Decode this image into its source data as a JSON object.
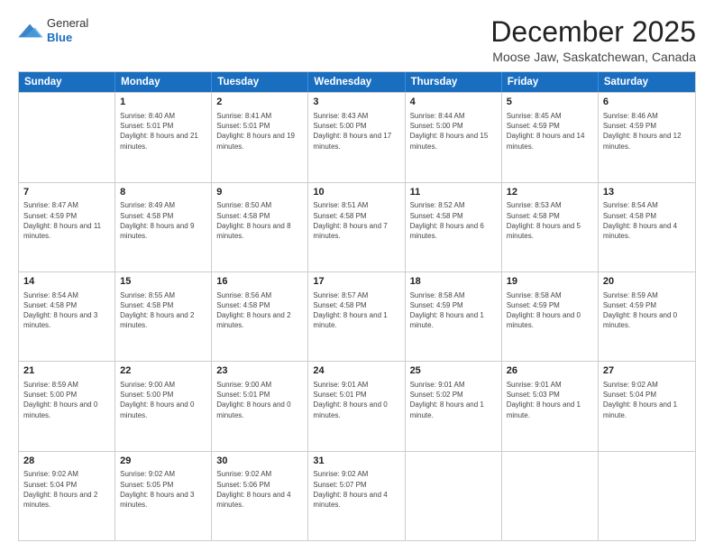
{
  "header": {
    "logo": {
      "line1": "General",
      "line2": "Blue"
    },
    "title": "December 2025",
    "subtitle": "Moose Jaw, Saskatchewan, Canada"
  },
  "calendar": {
    "days_of_week": [
      "Sunday",
      "Monday",
      "Tuesday",
      "Wednesday",
      "Thursday",
      "Friday",
      "Saturday"
    ],
    "rows": [
      [
        {
          "day": "",
          "sunrise": "",
          "sunset": "",
          "daylight": ""
        },
        {
          "day": "1",
          "sunrise": "Sunrise: 8:40 AM",
          "sunset": "Sunset: 5:01 PM",
          "daylight": "Daylight: 8 hours and 21 minutes."
        },
        {
          "day": "2",
          "sunrise": "Sunrise: 8:41 AM",
          "sunset": "Sunset: 5:01 PM",
          "daylight": "Daylight: 8 hours and 19 minutes."
        },
        {
          "day": "3",
          "sunrise": "Sunrise: 8:43 AM",
          "sunset": "Sunset: 5:00 PM",
          "daylight": "Daylight: 8 hours and 17 minutes."
        },
        {
          "day": "4",
          "sunrise": "Sunrise: 8:44 AM",
          "sunset": "Sunset: 5:00 PM",
          "daylight": "Daylight: 8 hours and 15 minutes."
        },
        {
          "day": "5",
          "sunrise": "Sunrise: 8:45 AM",
          "sunset": "Sunset: 4:59 PM",
          "daylight": "Daylight: 8 hours and 14 minutes."
        },
        {
          "day": "6",
          "sunrise": "Sunrise: 8:46 AM",
          "sunset": "Sunset: 4:59 PM",
          "daylight": "Daylight: 8 hours and 12 minutes."
        }
      ],
      [
        {
          "day": "7",
          "sunrise": "Sunrise: 8:47 AM",
          "sunset": "Sunset: 4:59 PM",
          "daylight": "Daylight: 8 hours and 11 minutes."
        },
        {
          "day": "8",
          "sunrise": "Sunrise: 8:49 AM",
          "sunset": "Sunset: 4:58 PM",
          "daylight": "Daylight: 8 hours and 9 minutes."
        },
        {
          "day": "9",
          "sunrise": "Sunrise: 8:50 AM",
          "sunset": "Sunset: 4:58 PM",
          "daylight": "Daylight: 8 hours and 8 minutes."
        },
        {
          "day": "10",
          "sunrise": "Sunrise: 8:51 AM",
          "sunset": "Sunset: 4:58 PM",
          "daylight": "Daylight: 8 hours and 7 minutes."
        },
        {
          "day": "11",
          "sunrise": "Sunrise: 8:52 AM",
          "sunset": "Sunset: 4:58 PM",
          "daylight": "Daylight: 8 hours and 6 minutes."
        },
        {
          "day": "12",
          "sunrise": "Sunrise: 8:53 AM",
          "sunset": "Sunset: 4:58 PM",
          "daylight": "Daylight: 8 hours and 5 minutes."
        },
        {
          "day": "13",
          "sunrise": "Sunrise: 8:54 AM",
          "sunset": "Sunset: 4:58 PM",
          "daylight": "Daylight: 8 hours and 4 minutes."
        }
      ],
      [
        {
          "day": "14",
          "sunrise": "Sunrise: 8:54 AM",
          "sunset": "Sunset: 4:58 PM",
          "daylight": "Daylight: 8 hours and 3 minutes."
        },
        {
          "day": "15",
          "sunrise": "Sunrise: 8:55 AM",
          "sunset": "Sunset: 4:58 PM",
          "daylight": "Daylight: 8 hours and 2 minutes."
        },
        {
          "day": "16",
          "sunrise": "Sunrise: 8:56 AM",
          "sunset": "Sunset: 4:58 PM",
          "daylight": "Daylight: 8 hours and 2 minutes."
        },
        {
          "day": "17",
          "sunrise": "Sunrise: 8:57 AM",
          "sunset": "Sunset: 4:58 PM",
          "daylight": "Daylight: 8 hours and 1 minute."
        },
        {
          "day": "18",
          "sunrise": "Sunrise: 8:58 AM",
          "sunset": "Sunset: 4:59 PM",
          "daylight": "Daylight: 8 hours and 1 minute."
        },
        {
          "day": "19",
          "sunrise": "Sunrise: 8:58 AM",
          "sunset": "Sunset: 4:59 PM",
          "daylight": "Daylight: 8 hours and 0 minutes."
        },
        {
          "day": "20",
          "sunrise": "Sunrise: 8:59 AM",
          "sunset": "Sunset: 4:59 PM",
          "daylight": "Daylight: 8 hours and 0 minutes."
        }
      ],
      [
        {
          "day": "21",
          "sunrise": "Sunrise: 8:59 AM",
          "sunset": "Sunset: 5:00 PM",
          "daylight": "Daylight: 8 hours and 0 minutes."
        },
        {
          "day": "22",
          "sunrise": "Sunrise: 9:00 AM",
          "sunset": "Sunset: 5:00 PM",
          "daylight": "Daylight: 8 hours and 0 minutes."
        },
        {
          "day": "23",
          "sunrise": "Sunrise: 9:00 AM",
          "sunset": "Sunset: 5:01 PM",
          "daylight": "Daylight: 8 hours and 0 minutes."
        },
        {
          "day": "24",
          "sunrise": "Sunrise: 9:01 AM",
          "sunset": "Sunset: 5:01 PM",
          "daylight": "Daylight: 8 hours and 0 minutes."
        },
        {
          "day": "25",
          "sunrise": "Sunrise: 9:01 AM",
          "sunset": "Sunset: 5:02 PM",
          "daylight": "Daylight: 8 hours and 1 minute."
        },
        {
          "day": "26",
          "sunrise": "Sunrise: 9:01 AM",
          "sunset": "Sunset: 5:03 PM",
          "daylight": "Daylight: 8 hours and 1 minute."
        },
        {
          "day": "27",
          "sunrise": "Sunrise: 9:02 AM",
          "sunset": "Sunset: 5:04 PM",
          "daylight": "Daylight: 8 hours and 1 minute."
        }
      ],
      [
        {
          "day": "28",
          "sunrise": "Sunrise: 9:02 AM",
          "sunset": "Sunset: 5:04 PM",
          "daylight": "Daylight: 8 hours and 2 minutes."
        },
        {
          "day": "29",
          "sunrise": "Sunrise: 9:02 AM",
          "sunset": "Sunset: 5:05 PM",
          "daylight": "Daylight: 8 hours and 3 minutes."
        },
        {
          "day": "30",
          "sunrise": "Sunrise: 9:02 AM",
          "sunset": "Sunset: 5:06 PM",
          "daylight": "Daylight: 8 hours and 4 minutes."
        },
        {
          "day": "31",
          "sunrise": "Sunrise: 9:02 AM",
          "sunset": "Sunset: 5:07 PM",
          "daylight": "Daylight: 8 hours and 4 minutes."
        },
        {
          "day": "",
          "sunrise": "",
          "sunset": "",
          "daylight": ""
        },
        {
          "day": "",
          "sunrise": "",
          "sunset": "",
          "daylight": ""
        },
        {
          "day": "",
          "sunrise": "",
          "sunset": "",
          "daylight": ""
        }
      ]
    ]
  }
}
